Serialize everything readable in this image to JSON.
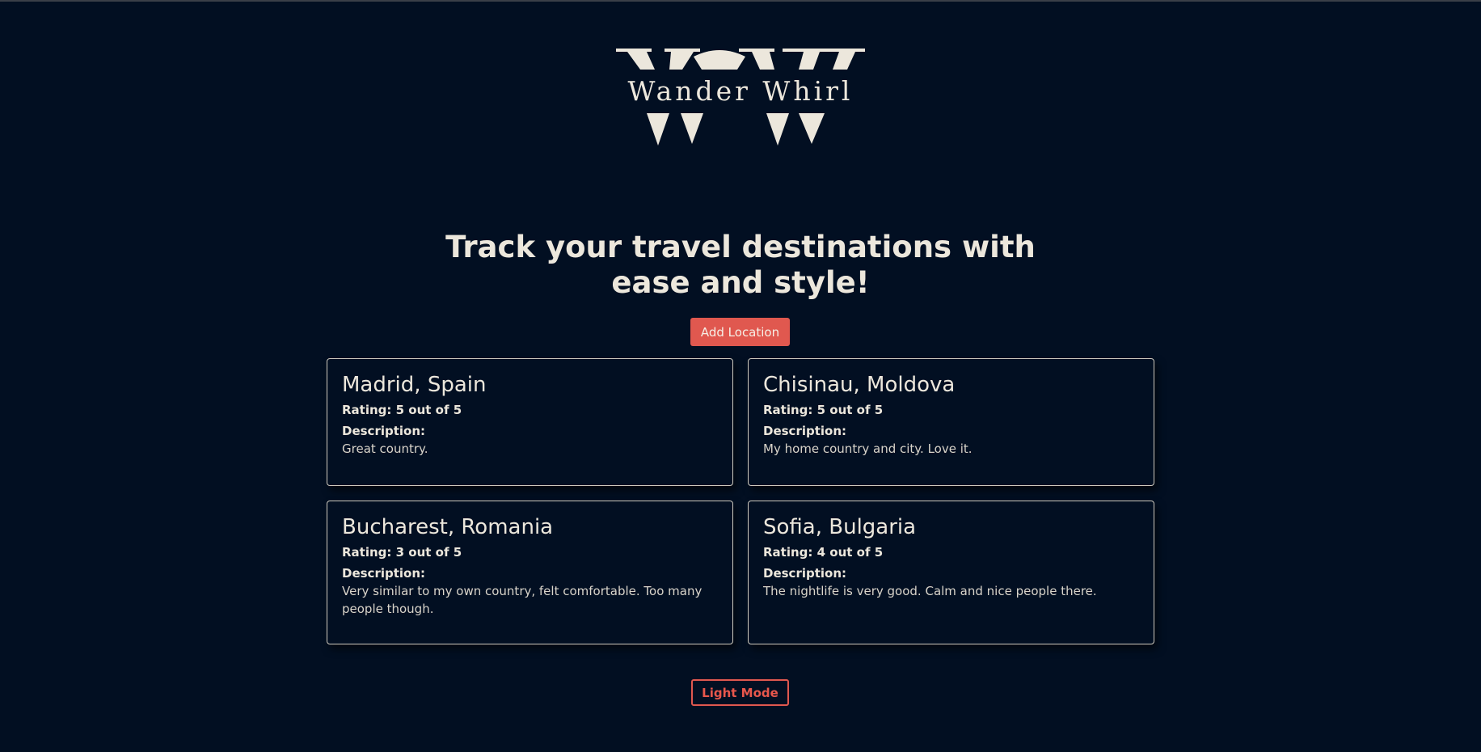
{
  "brand": {
    "name": "Wander Whirl",
    "logo_color": "#ece7dc"
  },
  "hero": {
    "title": "Track your travel destinations with ease and style!"
  },
  "actions": {
    "add_location_label": "Add Location",
    "theme_toggle_label": "Light Mode"
  },
  "colors": {
    "background": "#020f22",
    "accent": "#e0584f",
    "text": "#ece7dc",
    "card_border": "#cfcabf"
  },
  "locations": [
    {
      "title": "Madrid, Spain",
      "rating": "Rating: 5 out of 5",
      "description_label": "Description:",
      "description": "Great country."
    },
    {
      "title": "Chisinau, Moldova",
      "rating": "Rating: 5 out of 5",
      "description_label": "Description:",
      "description": "My home country and city. Love it."
    },
    {
      "title": "Bucharest, Romania",
      "rating": "Rating: 3 out of 5",
      "description_label": "Description:",
      "description": "Very similar to my own country, felt comfortable. Too many people though."
    },
    {
      "title": "Sofia, Bulgaria",
      "rating": "Rating: 4 out of 5",
      "description_label": "Description:",
      "description": "The nightlife is very good. Calm and nice people there."
    }
  ]
}
